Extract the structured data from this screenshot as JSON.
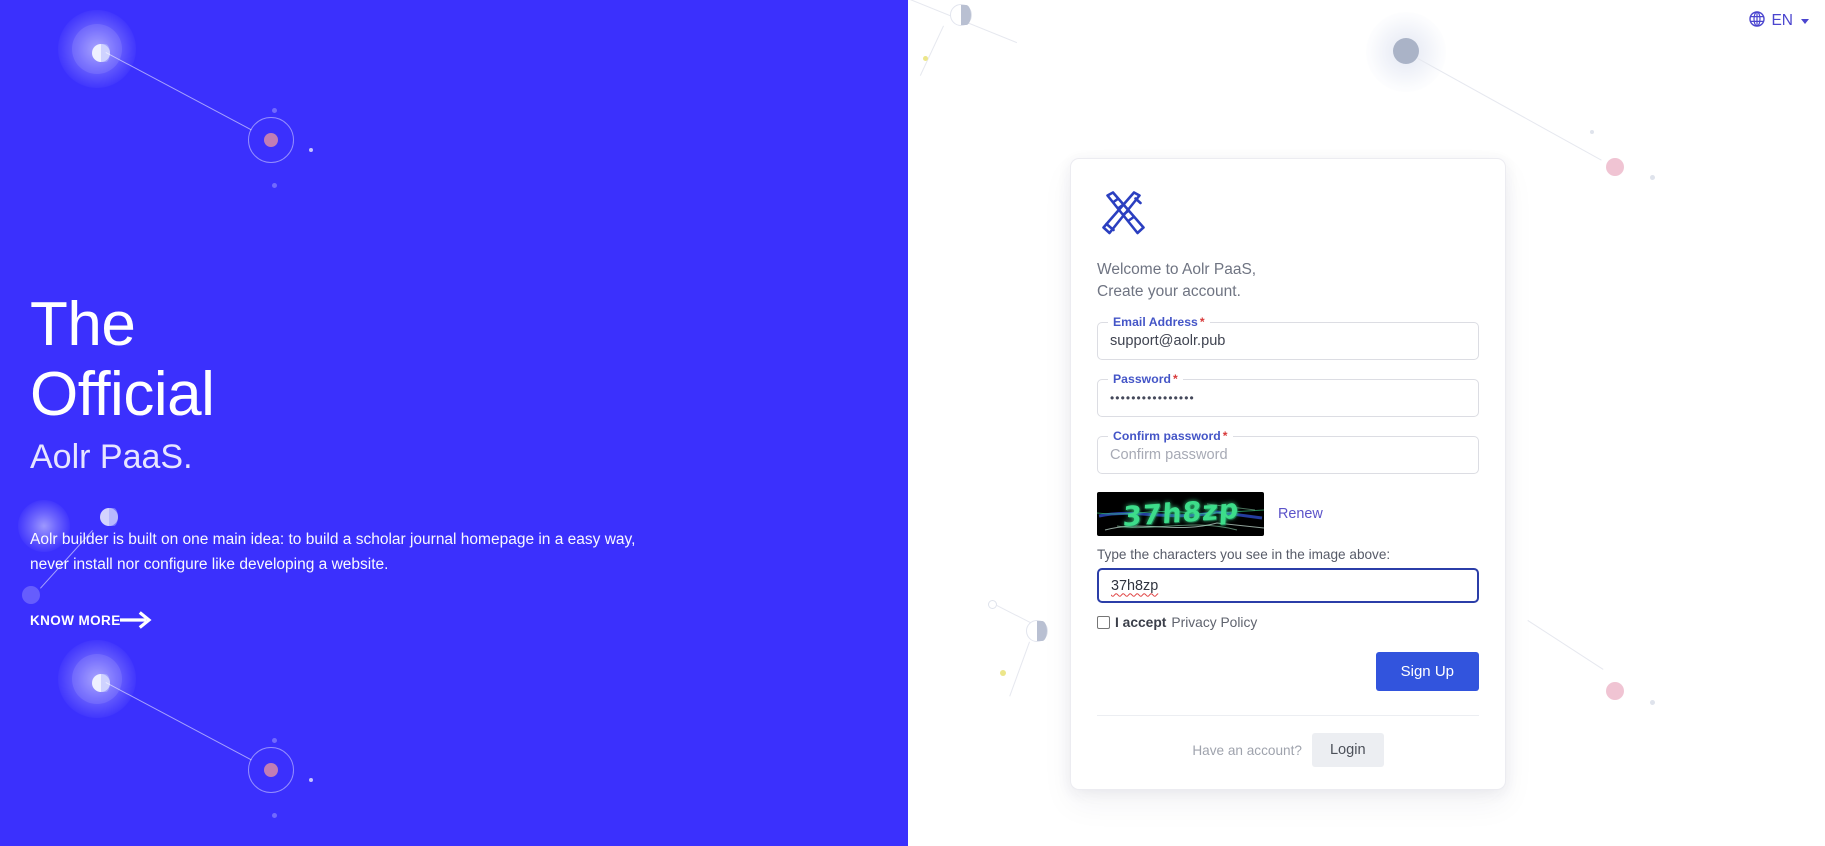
{
  "colors": {
    "brand_blue": "#3b30fd",
    "accent_button": "#3254dd",
    "label_blue": "#4455c7",
    "required_red": "#d83a3a",
    "captcha_green": "#3ddd8a",
    "link_purple": "#5b53c9"
  },
  "language_switcher": {
    "icon": "globe-icon",
    "code": "EN",
    "caret": "chevron-down-icon"
  },
  "hero": {
    "line1": "The",
    "line2": "Official",
    "line3": "Aolr PaaS.",
    "description": "Aolr builder is built on one main idea: to build a scholar journal homepage in a easy way, never install nor configure like developing a website.",
    "cta_label": "KNOW MORE",
    "cta_icon": "arrow-right-icon"
  },
  "card": {
    "logo_icon": "pencil-ruler-icon",
    "welcome_line1": "Welcome to Aolr PaaS,",
    "welcome_line2": "Create your account.",
    "fields": [
      {
        "name": "email",
        "label": "Email Address",
        "required_mark": "*",
        "value": "support@aolr.pub",
        "placeholder": "Email Address",
        "is_placeholder": false,
        "focused": false
      },
      {
        "name": "password",
        "label": "Password",
        "required_mark": "*",
        "value": "••••••••••••••••",
        "placeholder": "Password",
        "is_placeholder": false,
        "focused": false
      },
      {
        "name": "confirm-password",
        "label": "Confirm password",
        "required_mark": "*",
        "value": "Confirm password",
        "placeholder": "Confirm password",
        "is_placeholder": true,
        "focused": false
      }
    ],
    "captcha": {
      "image_text": "37h8zp",
      "renew_label": "Renew",
      "hint": "Type the characters you see in the image above:",
      "input_value": "37h8zp",
      "input_focused": true,
      "spellcheck_error": true
    },
    "privacy": {
      "checked": false,
      "accept_text": "I accept",
      "policy_link": "Privacy Policy"
    },
    "signup_label": "Sign Up",
    "footer": {
      "have_account": "Have an account?",
      "login_label": "Login"
    }
  }
}
